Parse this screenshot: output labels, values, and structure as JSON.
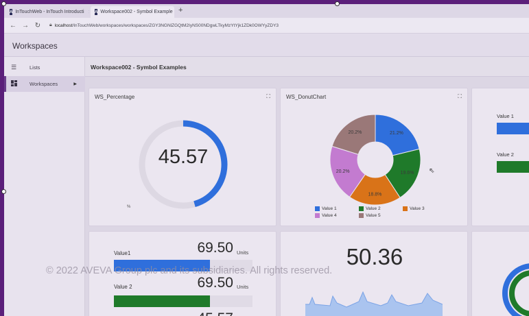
{
  "browser": {
    "tabs": [
      {
        "title": "InTouchWeb - InTouch Introducti",
        "active": false
      },
      {
        "title": "Workspace002 - Symbol Example",
        "active": true
      }
    ],
    "new_tab_icon": "plus-icon",
    "url_host": "localhost",
    "url_path": "/InTouchWeb/workspaces/workspaces/ZGY3NGNlZGQtM2IyNS00NDgwLTkyMzYtYjk1ZDk0OWYyZDY3"
  },
  "app": {
    "title": "Workspaces"
  },
  "sidebar": {
    "items": [
      {
        "label": "Lists",
        "icon": "list-icon",
        "selected": false
      },
      {
        "label": "Workspaces",
        "icon": "dashboard-icon",
        "selected": true
      }
    ]
  },
  "workspace": {
    "title": "Workspace002 - Symbol Examples"
  },
  "cards": {
    "percentage": {
      "title": "WS_Percentage",
      "value": "45.57",
      "fraction": 0.4557,
      "unit": "%",
      "color": "#2f6fdc"
    },
    "donut": {
      "title": "WS_DonutChart"
    },
    "bars3": {
      "items": [
        {
          "label": "Value 1",
          "color": "#2f6fdc"
        },
        {
          "label": "Value 2",
          "color": "#1f7a2a"
        }
      ]
    },
    "values": {
      "rows": [
        {
          "label": "Value1",
          "value": "69.50",
          "unit": "Units",
          "fraction": 0.695,
          "color": "#2f6fdc"
        },
        {
          "label": "Value 2",
          "value": "69.50",
          "unit": "Units",
          "fraction": 0.695,
          "color": "#1f7a2a"
        },
        {
          "label": "",
          "value": "45.57",
          "unit": "",
          "fraction": 0.4557,
          "color": "#2f6fdc"
        }
      ]
    },
    "trend": {
      "value": "50.36"
    }
  },
  "chart_data": {
    "type": "pie",
    "variant": "donut",
    "series": [
      {
        "name": "Value 1",
        "value": 21.2,
        "label": "21.2%",
        "color": "#2f6fdc"
      },
      {
        "name": "Value 2",
        "value": 19.6,
        "label": "19.6%",
        "color": "#1f7a2a"
      },
      {
        "name": "Value 3",
        "value": 18.8,
        "label": "18.8%",
        "color": "#d97318"
      },
      {
        "name": "Value 4",
        "value": 20.2,
        "label": "20.2%",
        "color": "#c37bd0"
      },
      {
        "name": "Value 5",
        "value": 20.2,
        "label": "20.2%",
        "color": "#9a7878"
      }
    ],
    "legend_position": "bottom"
  },
  "footer": {
    "copyright": "© 2022 AVEVA Group plc and its subsidiaries. All rights reserved."
  }
}
